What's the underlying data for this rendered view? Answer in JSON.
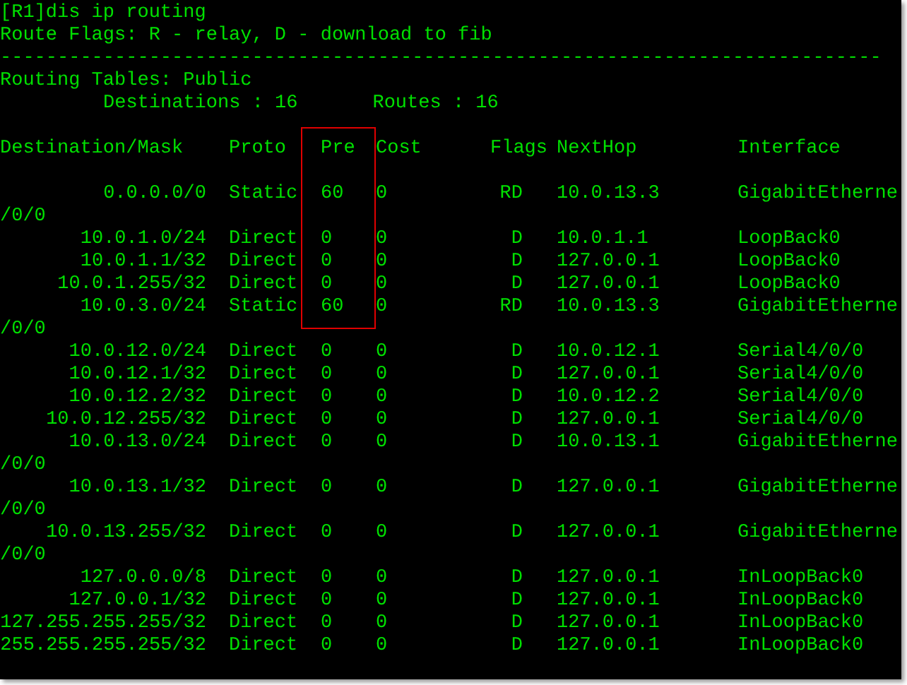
{
  "prompt_line": "[R1]dis ip routing",
  "flags_legend": "Route Flags: R - relay, D - download to fib",
  "separator": "-----------------------------------------------------------------------------",
  "table_title": "Routing Tables: Public",
  "summary": [
    "Destinations : 16",
    "Routes : 16"
  ],
  "columns": [
    {
      "label": "Destination/Mask",
      "highlighted": false
    },
    {
      "label": "Proto",
      "highlighted": false
    },
    {
      "label": "Pre",
      "highlighted": true
    },
    {
      "label": "Cost",
      "highlighted": false
    },
    {
      "label": "Flags",
      "highlighted": false
    },
    {
      "label": "NextHop",
      "highlighted": false
    },
    {
      "label": "Interface",
      "highlighted": false
    }
  ],
  "rows": [
    {
      "destination": "0.0.0.0/0",
      "proto": "Static",
      "pre": "60",
      "cost": "0",
      "flags": "RD",
      "nexthop": "10.0.13.3",
      "interface": "GigabitEtherne",
      "continuation": "/0/0",
      "highlighted": true
    },
    {
      "destination": "10.0.1.0/24",
      "proto": "Direct",
      "pre": "0",
      "cost": "0",
      "flags": "D",
      "nexthop": "10.0.1.1",
      "interface": "LoopBack0",
      "highlighted": true
    },
    {
      "destination": "10.0.1.1/32",
      "proto": "Direct",
      "pre": "0",
      "cost": "0",
      "flags": "D",
      "nexthop": "127.0.0.1",
      "interface": "LoopBack0",
      "highlighted": true
    },
    {
      "destination": "10.0.1.255/32",
      "proto": "Direct",
      "pre": "0",
      "cost": "0",
      "flags": "D",
      "nexthop": "127.0.0.1",
      "interface": "LoopBack0",
      "highlighted": true
    },
    {
      "destination": "10.0.3.0/24",
      "proto": "Static",
      "pre": "60",
      "cost": "0",
      "flags": "RD",
      "nexthop": "10.0.13.3",
      "interface": "GigabitEtherne",
      "continuation": "/0/0",
      "highlighted": true
    },
    {
      "destination": "10.0.12.0/24",
      "proto": "Direct",
      "pre": "0",
      "cost": "0",
      "flags": "D",
      "nexthop": "10.0.12.1",
      "interface": "Serial4/0/0",
      "highlighted": false
    },
    {
      "destination": "10.0.12.1/32",
      "proto": "Direct",
      "pre": "0",
      "cost": "0",
      "flags": "D",
      "nexthop": "127.0.0.1",
      "interface": "Serial4/0/0",
      "highlighted": false
    },
    {
      "destination": "10.0.12.2/32",
      "proto": "Direct",
      "pre": "0",
      "cost": "0",
      "flags": "D",
      "nexthop": "10.0.12.2",
      "interface": "Serial4/0/0",
      "highlighted": false
    },
    {
      "destination": "10.0.12.255/32",
      "proto": "Direct",
      "pre": "0",
      "cost": "0",
      "flags": "D",
      "nexthop": "127.0.0.1",
      "interface": "Serial4/0/0",
      "highlighted": false
    },
    {
      "destination": "10.0.13.0/24",
      "proto": "Direct",
      "pre": "0",
      "cost": "0",
      "flags": "D",
      "nexthop": "10.0.13.1",
      "interface": "GigabitEtherne",
      "continuation": "/0/0",
      "highlighted": false
    },
    {
      "destination": "10.0.13.1/32",
      "proto": "Direct",
      "pre": "0",
      "cost": "0",
      "flags": "D",
      "nexthop": "127.0.0.1",
      "interface": "GigabitEtherne",
      "continuation": "/0/0",
      "highlighted": false
    },
    {
      "destination": "10.0.13.255/32",
      "proto": "Direct",
      "pre": "0",
      "cost": "0",
      "flags": "D",
      "nexthop": "127.0.0.1",
      "interface": "GigabitEtherne",
      "continuation": "/0/0",
      "highlighted": false
    },
    {
      "destination": "127.0.0.0/8",
      "proto": "Direct",
      "pre": "0",
      "cost": "0",
      "flags": "D",
      "nexthop": "127.0.0.1",
      "interface": "InLoopBack0",
      "highlighted": false
    },
    {
      "destination": "127.0.0.1/32",
      "proto": "Direct",
      "pre": "0",
      "cost": "0",
      "flags": "D",
      "nexthop": "127.0.0.1",
      "interface": "InLoopBack0",
      "highlighted": false
    },
    {
      "destination": "127.255.255.255/32",
      "proto": "Direct",
      "pre": "0",
      "cost": "0",
      "flags": "D",
      "nexthop": "127.0.0.1",
      "interface": "InLoopBack0",
      "highlighted": false
    },
    {
      "destination": "255.255.255.255/32",
      "proto": "Direct",
      "pre": "0",
      "cost": "0",
      "flags": "D",
      "nexthop": "127.0.0.1",
      "interface": "InLoopBack0",
      "highlighted": false
    }
  ]
}
